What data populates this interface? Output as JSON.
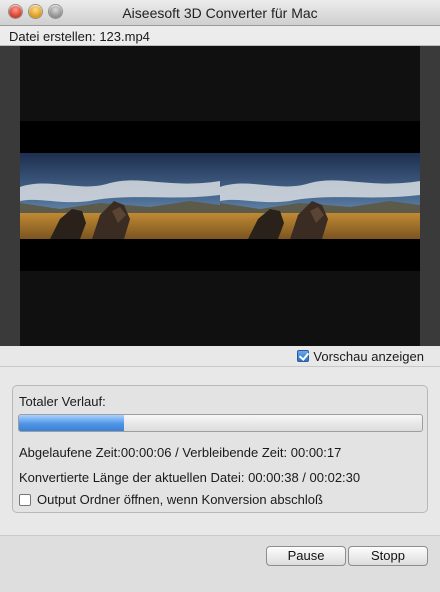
{
  "window": {
    "title": "Aiseesoft 3D Converter für Mac"
  },
  "file_bar": {
    "text": "Datei erstellen: 123.mp4"
  },
  "preview": {
    "show_preview_label": "Vorschau anzeigen",
    "show_preview_checked": true
  },
  "progress": {
    "label": "Totaler Verlauf:",
    "fraction": 0.26,
    "elapsed_line": "Abgelaufene Zeit:00:00:06 / Verbleibende Zeit: 00:00:17",
    "length_line": "Konvertierte Länge der aktuellen Datei: 00:00:38 / 00:02:30",
    "open_output_label": "Output Ordner öffnen, wenn Konversion abschloß",
    "open_output_checked": false
  },
  "buttons": {
    "pause": "Pause",
    "stop": "Stopp"
  },
  "colors": {
    "progress_fill": "#4f95e5",
    "checkbox_checked": "#2c6fc8"
  }
}
